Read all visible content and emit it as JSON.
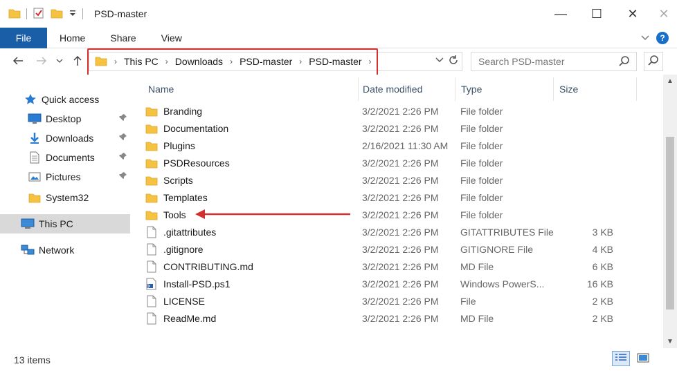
{
  "window": {
    "title": "PSD-master",
    "minimize": "—",
    "maximize": "☐",
    "close": "✕",
    "close2": "✕"
  },
  "ribbon": {
    "tabs": [
      "File",
      "Home",
      "Share",
      "View"
    ],
    "help": "?"
  },
  "address": {
    "crumbs": [
      "This PC",
      "Downloads",
      "PSD-master",
      "PSD-master"
    ],
    "search_placeholder": "Search PSD-master"
  },
  "sidebar": {
    "items": [
      {
        "label": "Quick access",
        "icon": "star-icon"
      },
      {
        "label": "Desktop",
        "icon": "desktop-icon",
        "pinned": true
      },
      {
        "label": "Downloads",
        "icon": "download-arrow-icon",
        "pinned": true
      },
      {
        "label": "Documents",
        "icon": "document-icon",
        "pinned": true
      },
      {
        "label": "Pictures",
        "icon": "pictures-icon",
        "pinned": true
      },
      {
        "label": "System32",
        "icon": "folder-icon"
      },
      {
        "label": "This PC",
        "icon": "computer-icon",
        "selected": true
      },
      {
        "label": "Network",
        "icon": "network-icon"
      }
    ]
  },
  "columns": {
    "name": "Name",
    "date": "Date modified",
    "type": "Type",
    "size": "Size"
  },
  "files": [
    {
      "name": "Branding",
      "date": "3/2/2021 2:26 PM",
      "type": "File folder",
      "size": "",
      "icon": "folder-icon"
    },
    {
      "name": "Documentation",
      "date": "3/2/2021 2:26 PM",
      "type": "File folder",
      "size": "",
      "icon": "folder-icon"
    },
    {
      "name": "Plugins",
      "date": "2/16/2021 11:30 AM",
      "type": "File folder",
      "size": "",
      "icon": "folder-icon"
    },
    {
      "name": "PSDResources",
      "date": "3/2/2021 2:26 PM",
      "type": "File folder",
      "size": "",
      "icon": "folder-icon"
    },
    {
      "name": "Scripts",
      "date": "3/2/2021 2:26 PM",
      "type": "File folder",
      "size": "",
      "icon": "folder-icon"
    },
    {
      "name": "Templates",
      "date": "3/2/2021 2:26 PM",
      "type": "File folder",
      "size": "",
      "icon": "folder-icon"
    },
    {
      "name": "Tools",
      "date": "3/2/2021 2:26 PM",
      "type": "File folder",
      "size": "",
      "icon": "folder-icon"
    },
    {
      "name": ".gitattributes",
      "date": "3/2/2021 2:26 PM",
      "type": "GITATTRIBUTES File",
      "size": "3 KB",
      "icon": "file-icon"
    },
    {
      "name": ".gitignore",
      "date": "3/2/2021 2:26 PM",
      "type": "GITIGNORE File",
      "size": "4 KB",
      "icon": "file-icon"
    },
    {
      "name": "CONTRIBUTING.md",
      "date": "3/2/2021 2:26 PM",
      "type": "MD File",
      "size": "6 KB",
      "icon": "file-icon"
    },
    {
      "name": "Install-PSD.ps1",
      "date": "3/2/2021 2:26 PM",
      "type": "Windows PowerS...",
      "size": "16 KB",
      "icon": "powershell-file-icon"
    },
    {
      "name": "LICENSE",
      "date": "3/2/2021 2:26 PM",
      "type": "File",
      "size": "2 KB",
      "icon": "file-icon"
    },
    {
      "name": "ReadMe.md",
      "date": "3/2/2021 2:26 PM",
      "type": "MD File",
      "size": "2 KB",
      "icon": "file-icon"
    }
  ],
  "status": {
    "count": "13 items"
  },
  "colors": {
    "accent": "#1a5ea8",
    "highlight": "#d32f2f",
    "folder": "#f5c242"
  }
}
